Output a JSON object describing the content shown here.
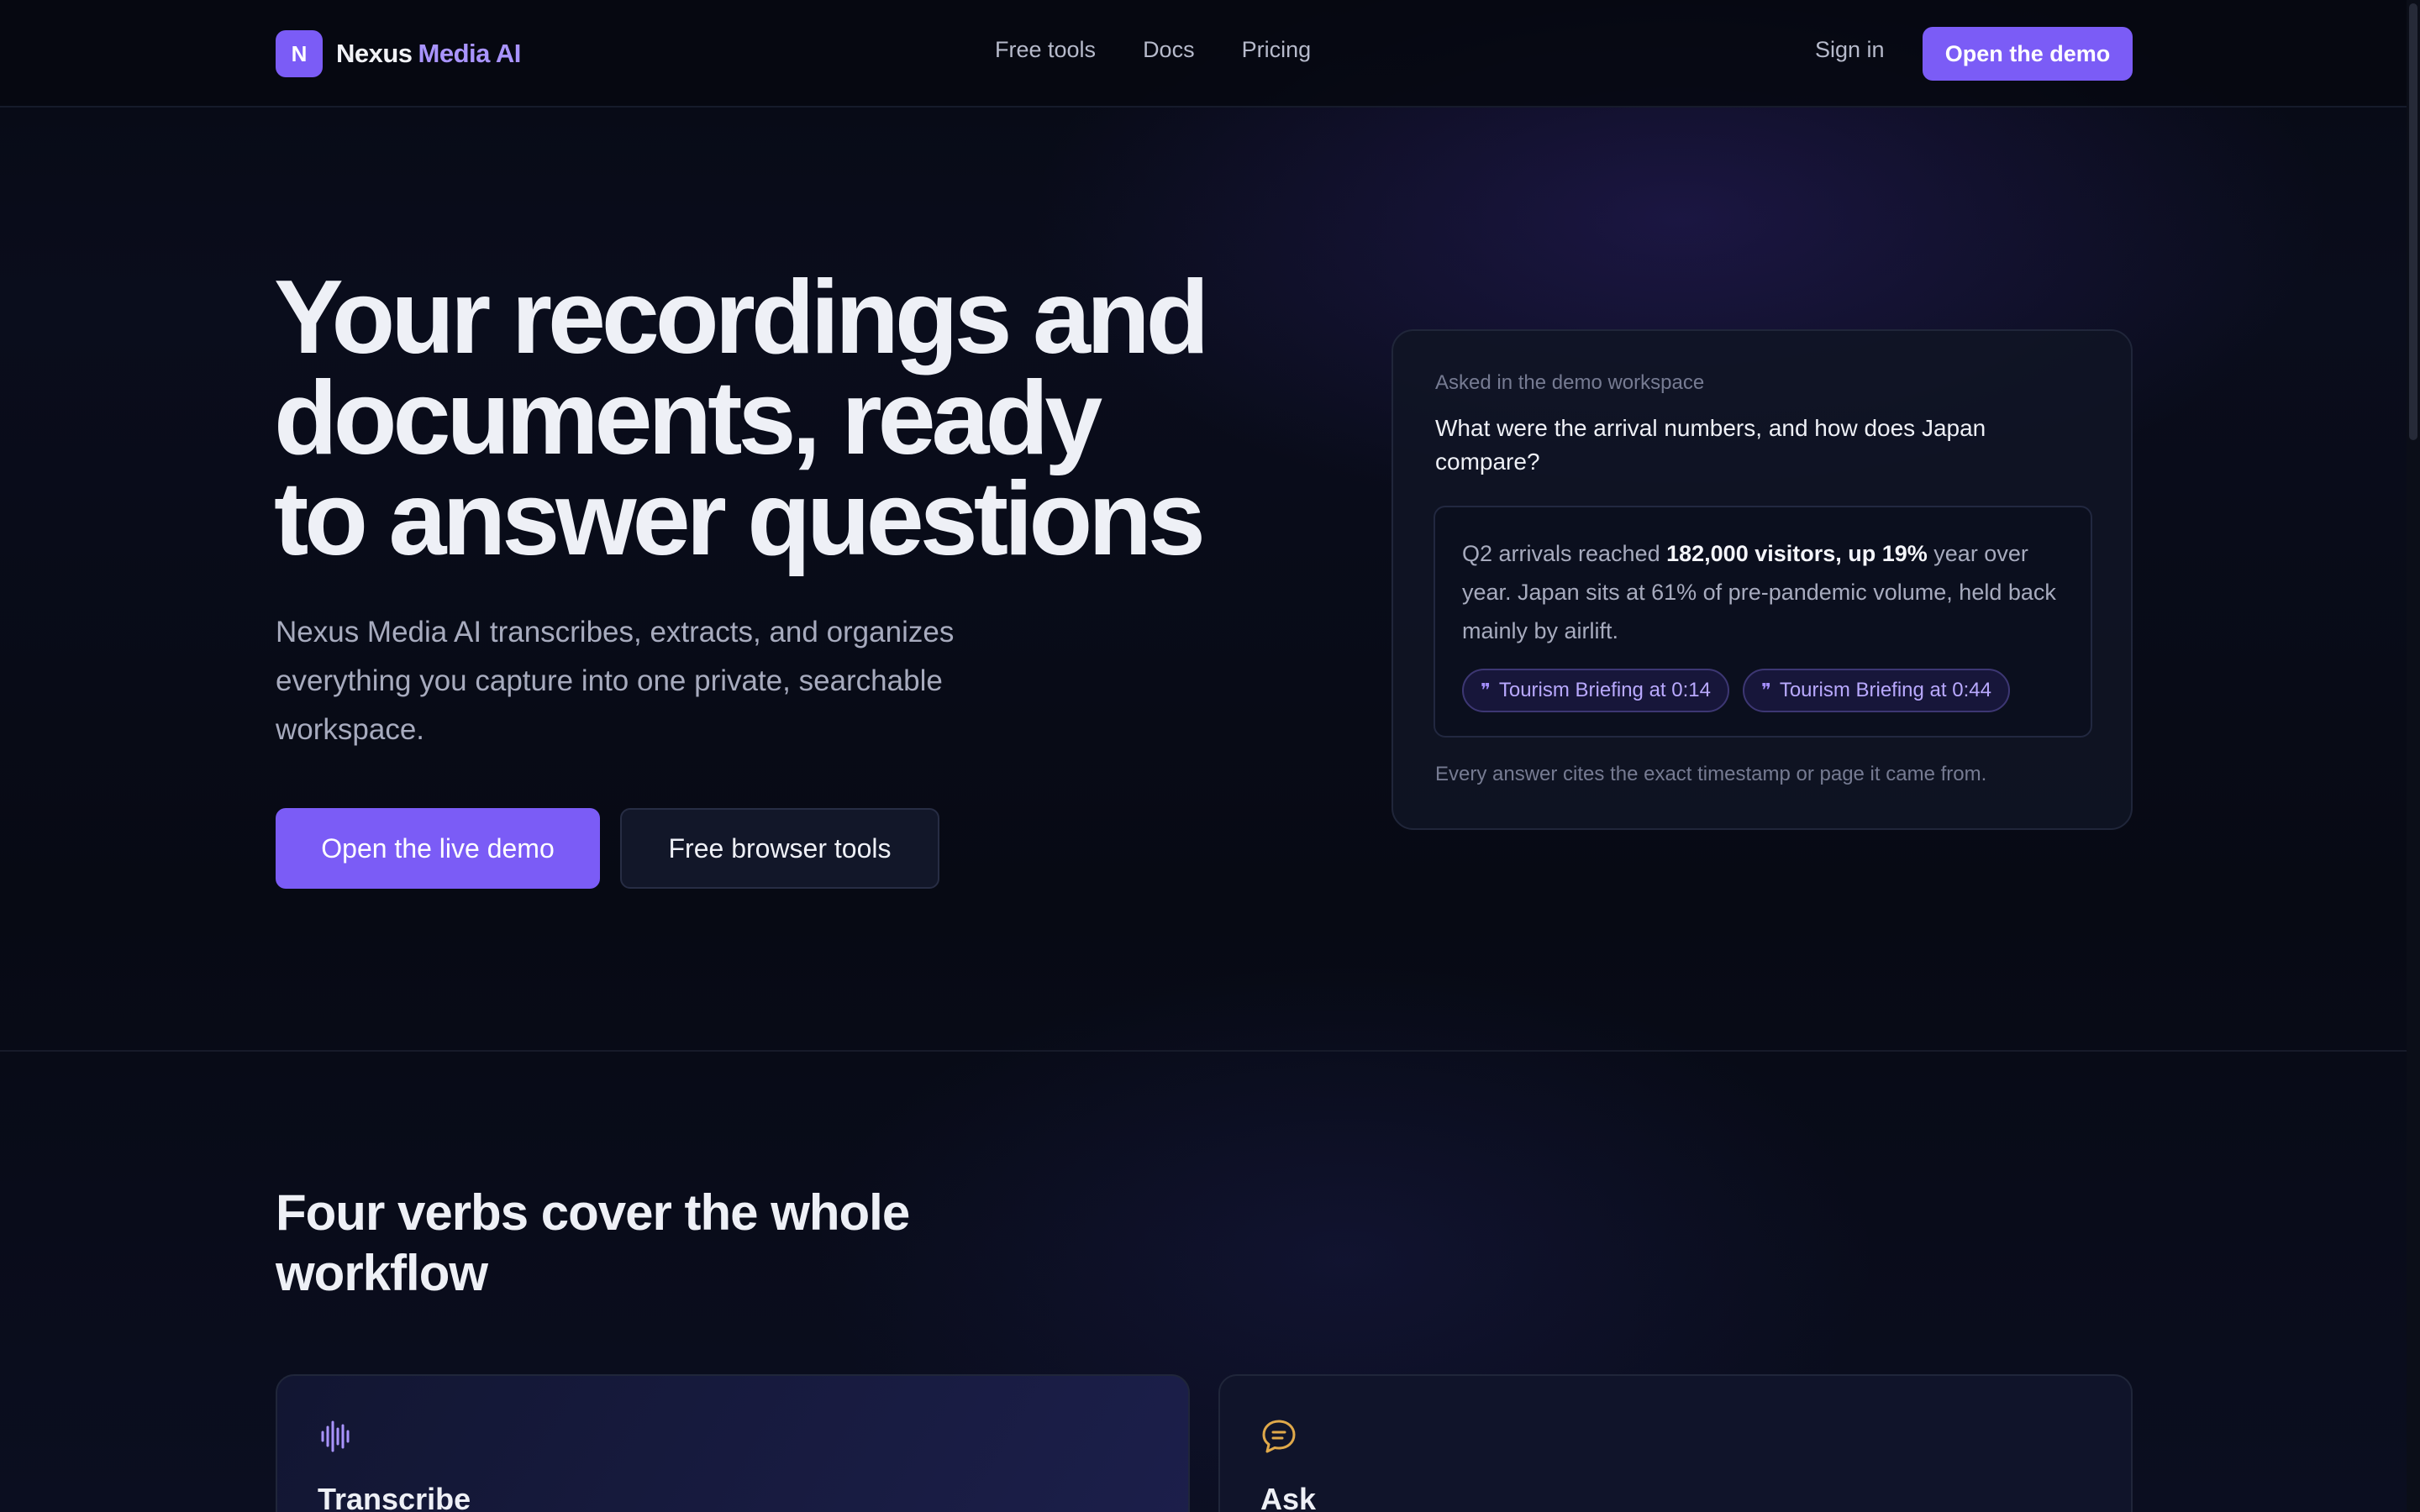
{
  "nav": {
    "brand_mark": "N",
    "brand_name": "Nexus",
    "brand_accent": "Media AI",
    "links": [
      "Free tools",
      "Docs",
      "Pricing"
    ],
    "sign_in": "Sign in",
    "cta": "Open the demo"
  },
  "hero": {
    "title_lines": [
      "Your recordings and",
      "documents, ready",
      "to answer questions"
    ],
    "subtitle": "Nexus Media AI transcribes, extracts, and organizes everything you capture into one private, searchable workspace.",
    "primary_button": "Open the live demo",
    "secondary_button": "Free browser tools"
  },
  "demo": {
    "kicker": "Asked in the demo workspace",
    "question": "What were the arrival numbers, and how does Japan compare?",
    "answer": {
      "before": "Q2 arrivals reached ",
      "bold": "182,000 visitors, up 19%",
      "after": " year over year. Japan sits at 61% of pre-pandemic volume, held back mainly by airlift."
    },
    "citations": [
      "Tourism Briefing at 0:14",
      "Tourism Briefing at 0:44"
    ],
    "footnote": "Every answer cites the exact timestamp or page it came from."
  },
  "section": {
    "title": "Four verbs cover the whole workflow",
    "cards": [
      {
        "title": "Transcribe",
        "icon": "waveform-icon"
      },
      {
        "title": "Ask",
        "icon": "chat-bubble-icon"
      }
    ]
  },
  "colors": {
    "accent": "#7b5cf6",
    "accent_light": "#a994ff",
    "background": "#070a14",
    "ask_icon": "#e0a94a"
  }
}
